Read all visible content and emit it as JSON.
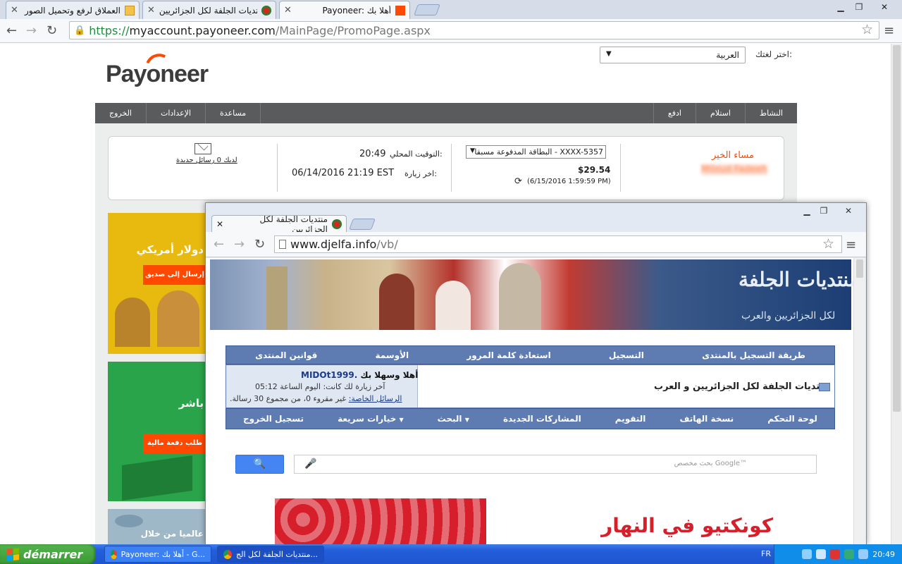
{
  "browser": {
    "tabs": [
      {
        "title": "العملاق لرفع وتحميل الصور",
        "active": false
      },
      {
        "title": "منتديات الجلفة لكل الجزائريين",
        "active": false
      },
      {
        "title": "Payoneer: أهلا بك",
        "active": true
      }
    ],
    "url_scheme": "https://",
    "url_host": "myaccount.payoneer.com",
    "url_path": "/MainPage/PromoPage.aspx"
  },
  "payoneer": {
    "logo_text": "Payoneer",
    "language_label": "اختر لغتك:",
    "language_value": "العربية",
    "nav_right": [
      "النشاط",
      "استلام",
      "ادفع"
    ],
    "nav_left": [
      "مساعدة",
      "الإعدادات",
      "الخروج"
    ],
    "greeting": "مساء الخير",
    "user_name": "Miloud Fadeeh",
    "card_select": "البطاقة المدفوعة مسبقا - XXXX-5357",
    "balance": "$29.54",
    "balance_time": "(6/15/2016 1:59:59 PM)",
    "local_time_label": "التوقيت المحلي:",
    "local_time": "20:49",
    "last_visit_label": "اخر زيارة:",
    "last_visit": "06/14/2016 21:19 EST",
    "messages_text": "لديك 0 رسائل جديدة",
    "promos": [
      {
        "text": "دولار أمريكي",
        "button": "إرسال إلى صديق",
        "color": "#e8b90f"
      },
      {
        "text": "باشر",
        "button": "طلب دفعة مالية",
        "color": "#2aa44a"
      },
      {
        "text": "عالميا من خلال",
        "button": "",
        "color": "#9fb8c7"
      }
    ]
  },
  "popup": {
    "tab_title": "منتديات الجلفة لكل الجزائريين",
    "url_host": "www.djelfa.info",
    "url_path": "/vb/",
    "banner_title": "منتديات الجلفة",
    "banner_sub": "لكل الجزائريين والعرب",
    "nav1": [
      "طريقة التسجيل بالمنتدى",
      "التسجيل",
      "استعادة كلمة المرور",
      "الأوسمة",
      "قوانين المنتدى"
    ],
    "forum_title": "منتديات الجلفة لكل الجزائريين و العرب",
    "welcome": "أهلا وسهلا بك",
    "username": "MIDOt1999.",
    "last_visit": "آخر زيارة لك كانت: اليوم الساعة 05:12",
    "private_msgs_label": "الرسائل الخاصة:",
    "private_msgs": "غير مقروء 0، من مجموع 30 رسالة.",
    "nav2": [
      "لوحة التحكم",
      "نسخة الهاتف",
      "التقويم",
      "المشاركات الجديدة",
      "البحث",
      "خيارات سريعة",
      "تسجيل الخروج"
    ],
    "search_placeholder": "بحث مخصص Google™",
    "ad_text": "كونكتيو في النهار"
  },
  "taskbar": {
    "start": "démarrer",
    "tasks": [
      "Payoneer: أهلا بك - G...",
      "منتديات الجلفة لكل الج..."
    ],
    "lang": "FR",
    "clock": "20:49"
  }
}
